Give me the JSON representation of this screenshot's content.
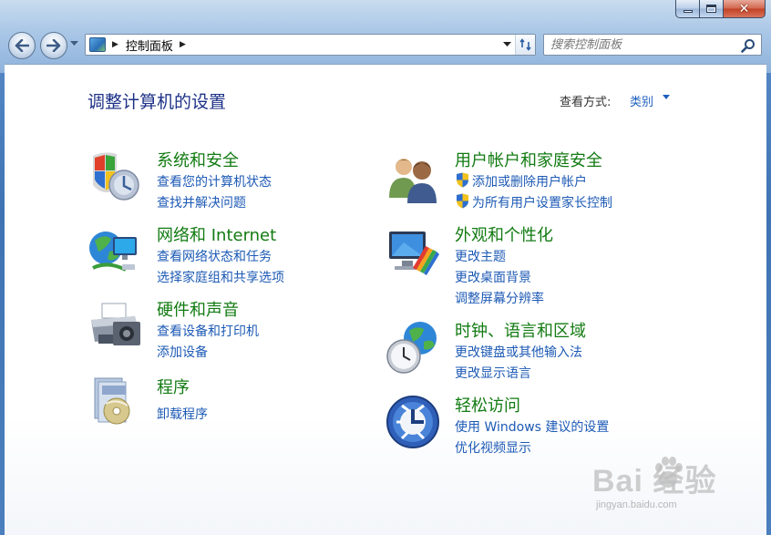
{
  "window": {
    "caption": {
      "close_glyph": "✕"
    }
  },
  "address": {
    "path": "控制面板",
    "separator": "▶"
  },
  "search": {
    "placeholder": "搜索控制面板"
  },
  "page": {
    "title": "调整计算机的设置",
    "view_label": "查看方式:",
    "view_value": "类别"
  },
  "categories": [
    {
      "title": "系统和安全",
      "links": [
        "查看您的计算机状态",
        "查找并解决问题"
      ],
      "icon": "security-shield-icon"
    },
    {
      "title": "网络和 Internet",
      "links": [
        "查看网络状态和任务",
        "选择家庭组和共享选项"
      ],
      "icon": "network-globe-icon"
    },
    {
      "title": "硬件和声音",
      "links": [
        "查看设备和打印机",
        "添加设备"
      ],
      "icon": "printer-icon"
    },
    {
      "title": "程序",
      "links": [
        "卸载程序"
      ],
      "icon": "programs-icon"
    },
    {
      "title": "用户帐户和家庭安全",
      "links": [
        "添加或删除用户帐户",
        "为所有用户设置家长控制"
      ],
      "icon": "users-icon"
    },
    {
      "title": "外观和个性化",
      "links": [
        "更改主题",
        "更改桌面背景",
        "调整屏幕分辨率"
      ],
      "icon": "monitor-palette-icon"
    },
    {
      "title": "时钟、语言和区域",
      "links": [
        "更改键盘或其他输入法",
        "更改显示语言"
      ],
      "icon": "clock-globe-icon"
    },
    {
      "title": "轻松访问",
      "links": [
        "使用 Windows 建议的设置",
        "优化视频显示"
      ],
      "icon": "ease-of-access-icon"
    }
  ],
  "watermark": {
    "brand": "Bai  经验",
    "url": "jingyan.baidu.com"
  }
}
